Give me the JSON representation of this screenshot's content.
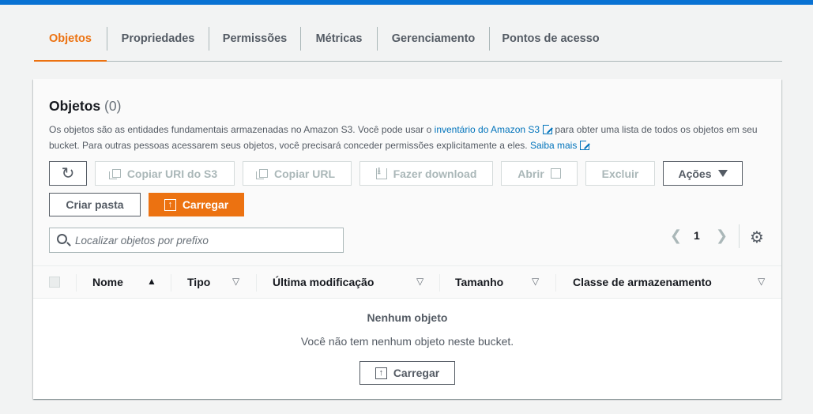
{
  "tabs": [
    {
      "label": "Objetos",
      "active": true
    },
    {
      "label": "Propriedades",
      "active": false
    },
    {
      "label": "Permissões",
      "active": false
    },
    {
      "label": "Métricas",
      "active": false
    },
    {
      "label": "Gerenciamento",
      "active": false
    },
    {
      "label": "Pontos de acesso",
      "active": false
    }
  ],
  "panel": {
    "title": "Objetos",
    "count": "(0)",
    "desc_part1": "Os objetos são as entidades fundamentais armazenadas no Amazon S3. Você pode usar o ",
    "desc_link1": "inventário do Amazon S3",
    "desc_part2": " para obter uma lista de todos os objetos em seu bucket. Para outras pessoas acessarem seus objetos, você precisará conceder permissões explicitamente a eles. ",
    "desc_link2": "Saiba mais"
  },
  "toolbar": {
    "copy_uri": "Copiar URI do S3",
    "copy_url": "Copiar URL",
    "download": "Fazer download",
    "open": "Abrir",
    "delete": "Excluir",
    "actions": "Ações",
    "create_folder": "Criar pasta",
    "upload": "Carregar"
  },
  "search": {
    "placeholder": "Localizar objetos por prefixo"
  },
  "pagination": {
    "current_page": "1"
  },
  "table": {
    "columns": [
      "Nome",
      "Tipo",
      "Última modificação",
      "Tamanho",
      "Classe de armazenamento"
    ],
    "sorted_column": "Nome",
    "sort_direction": "ascending"
  },
  "empty": {
    "title": "Nenhum objeto",
    "text": "Você não tem nenhum objeto neste bucket.",
    "button": "Carregar"
  },
  "colors": {
    "accent": "#ec7211",
    "topbar": "#0972d3",
    "link": "#0073bb"
  }
}
